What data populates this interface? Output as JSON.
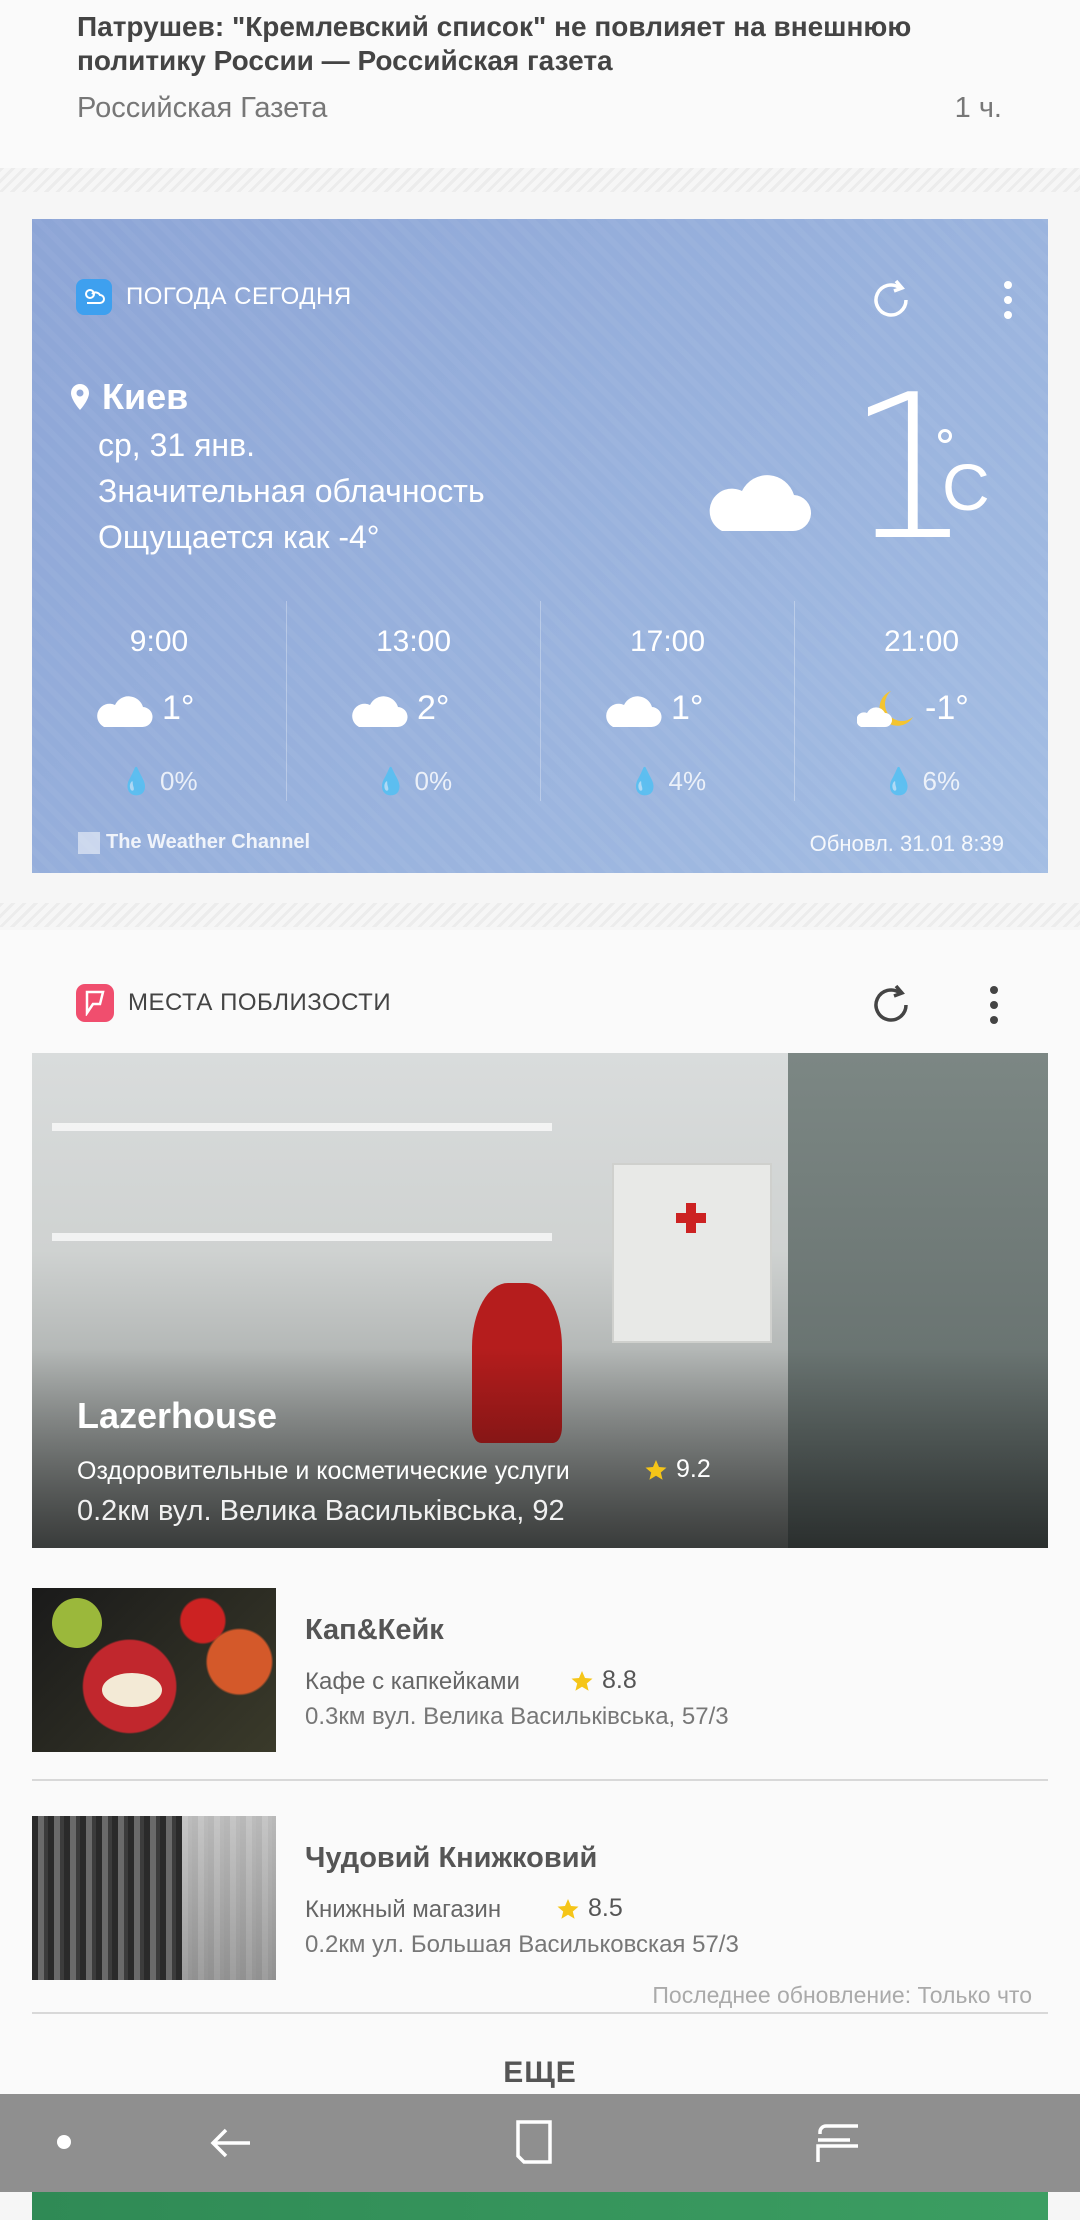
{
  "news": {
    "title": "Патрушев: \"Кремлевский список\" не повлияет на внешнюю политику России — Российская газета",
    "source": "Российская Газета",
    "time": "1 ч."
  },
  "weather": {
    "header": "ПОГОДА СЕГОДНЯ",
    "city": "Киев",
    "date": "ср, 31 янв.",
    "condition": "Значительная облачность",
    "feels_like": "Ощущается как -4°",
    "temp": "1",
    "unit": "C",
    "hours": [
      {
        "time": "9:00",
        "temp": "1°",
        "precip": "0%",
        "icon": "cloud-icon"
      },
      {
        "time": "13:00",
        "temp": "2°",
        "precip": "0%",
        "icon": "cloud-icon"
      },
      {
        "time": "17:00",
        "temp": "1°",
        "precip": "4%",
        "icon": "cloud-icon"
      },
      {
        "time": "21:00",
        "temp": "-1°",
        "precip": "6%",
        "icon": "moon-cloud-icon"
      }
    ],
    "source": "The Weather Channel",
    "updated": "Обновл. 31.01 8:39"
  },
  "places": {
    "header": "МЕСТА ПОБЛИЗОСТИ",
    "featured": {
      "name": "Lazerhouse",
      "category": "Оздоровительные и косметические услуги",
      "rating": "9.2",
      "address": "0.2км вул. Велика Васильківська, 92"
    },
    "items": [
      {
        "name": "Кап&Кейк",
        "category": "Кафе с капкейками",
        "rating": "8.8",
        "address": "0.3км вул. Велика Васильківська, 57/3"
      },
      {
        "name": "Чудовий Книжковий",
        "category": "Книжный магазин",
        "rating": "8.5",
        "address": "0.2км ул. Большая Васильковская 57/3"
      }
    ],
    "last_update": "Последнее обновление: Только что",
    "more": "ЕЩЕ"
  },
  "colors": {
    "weather_bg": "#8da5d6",
    "places_icon": "#f04e6e",
    "weather_icon": "#3ea0ef",
    "star": "#f5c518",
    "navbar": "#8f8f8f"
  }
}
